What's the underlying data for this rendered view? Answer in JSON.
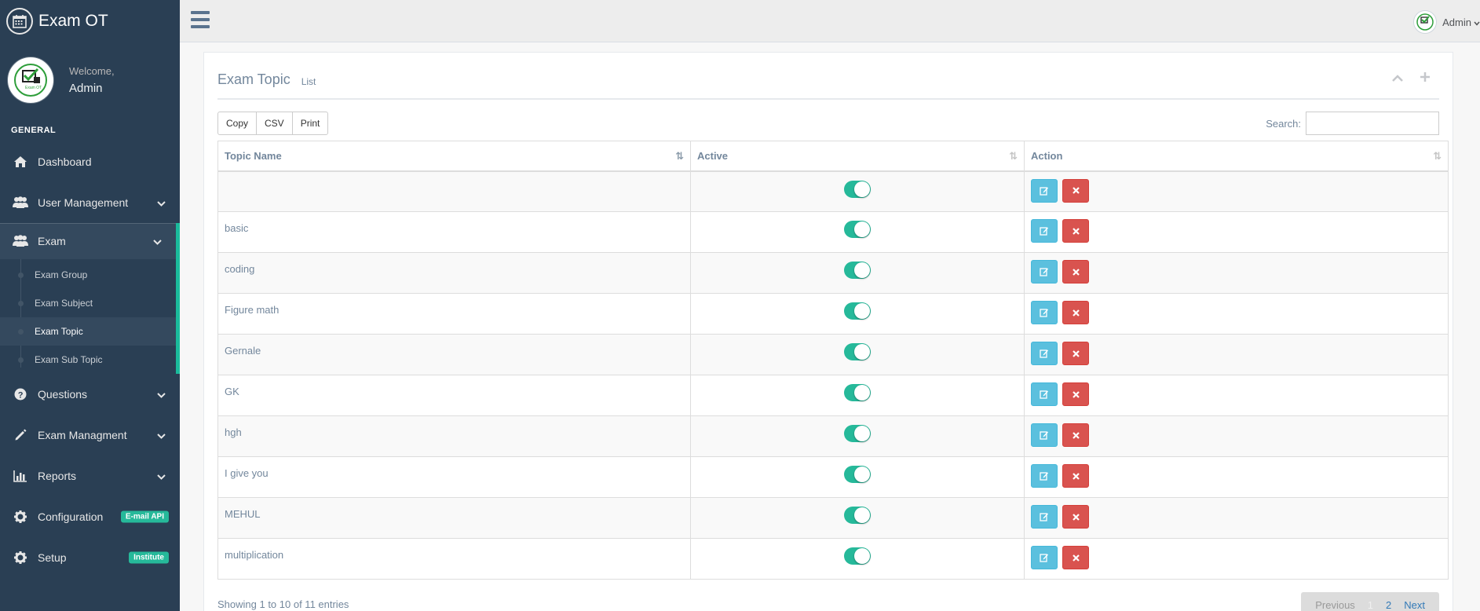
{
  "brand": {
    "title": "Exam OT",
    "logo_caption": "Exam OT"
  },
  "profile": {
    "welcome": "Welcome,",
    "name": "Admin"
  },
  "sidebar": {
    "section": "GENERAL",
    "items": [
      {
        "label": "Dashboard",
        "icon": "home-icon"
      },
      {
        "label": "User Management",
        "icon": "users-icon"
      },
      {
        "label": "Exam",
        "icon": "users-icon"
      },
      {
        "label": "Questions",
        "icon": "question-circle-icon"
      },
      {
        "label": "Exam Managment",
        "icon": "pencil-icon"
      },
      {
        "label": "Reports",
        "icon": "bar-chart-icon"
      },
      {
        "label": "Configuration",
        "icon": "gear-icon",
        "badge": "E-mail  API"
      },
      {
        "label": "Setup",
        "icon": "gear-icon",
        "badge": "Institute"
      }
    ],
    "exam_sub": [
      "Exam Group",
      "Exam Subject",
      "Exam Topic",
      "Exam Sub Topic"
    ],
    "active_sub": "Exam Topic"
  },
  "topnav": {
    "user": "Admin"
  },
  "panel": {
    "title": "Exam Topic",
    "subtitle": "List",
    "buttons": {
      "copy": "Copy",
      "csv": "CSV",
      "print": "Print"
    },
    "search_label": "Search:",
    "search_value": ""
  },
  "table": {
    "headers": {
      "topic": "Topic Name",
      "active": "Active",
      "action": "Action"
    },
    "rows": [
      {
        "name": "",
        "active": true
      },
      {
        "name": "basic",
        "active": true
      },
      {
        "name": "coding",
        "active": true
      },
      {
        "name": "Figure math",
        "active": true
      },
      {
        "name": "Gernale",
        "active": true
      },
      {
        "name": "GK",
        "active": true
      },
      {
        "name": "hgh",
        "active": true
      },
      {
        "name": "I give you",
        "active": true
      },
      {
        "name": "MEHUL",
        "active": true
      },
      {
        "name": "multiplication",
        "active": true
      }
    ],
    "info": "Showing 1 to 10 of 11 entries"
  },
  "pagination": {
    "prev": "Previous",
    "pages": [
      "1",
      "2"
    ],
    "current": "1",
    "next": "Next"
  },
  "colors": {
    "sidebar": "#2a3f54",
    "accent": "#1abb9c",
    "toggle_on": "#26b99a",
    "edit": "#5bc0de",
    "delete": "#d9534f"
  }
}
